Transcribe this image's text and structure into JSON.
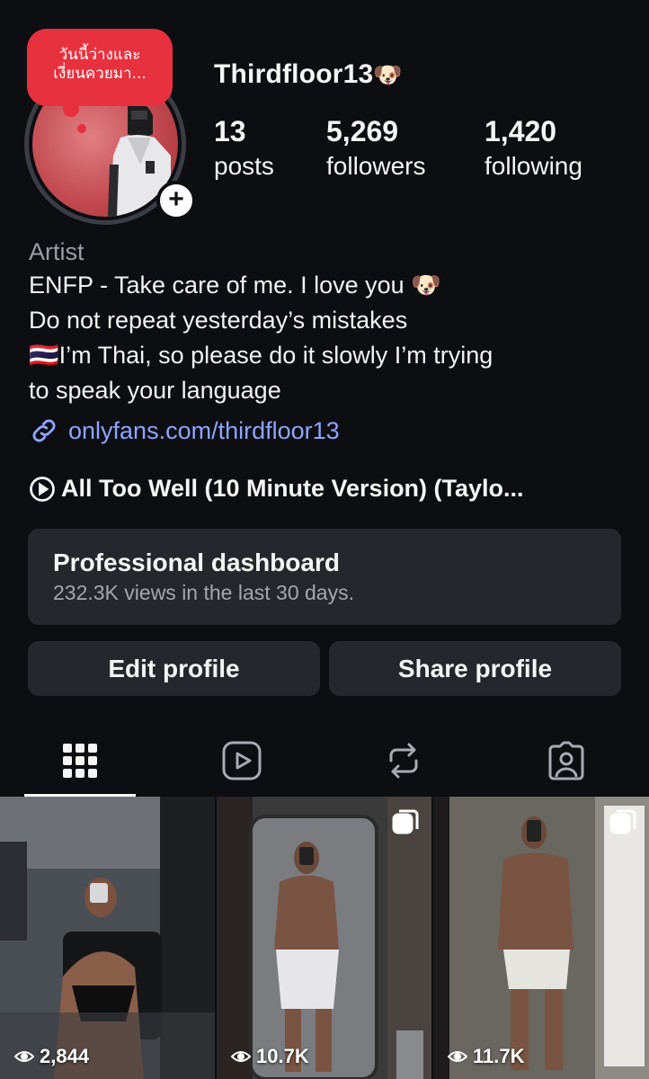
{
  "profile": {
    "note": [
      "วันนี้ว่างและ",
      "เงี่ยนควยมา..."
    ],
    "username": "Thirdfloor13",
    "username_emoji": "🐶",
    "stats": [
      {
        "value": "13",
        "label": "posts"
      },
      {
        "value": "5,269",
        "label": "followers"
      },
      {
        "value": "1,420",
        "label": "following"
      }
    ]
  },
  "bio": {
    "category": "Artist",
    "lines": [
      "ENFP - Take care of me. I love you 🐶",
      "Do not repeat yesterday’s mistakes",
      "🇹🇭I’m Thai, so please do it slowly I’m trying",
      "to speak your language"
    ],
    "link": "onlyfans.com/thirdfloor13",
    "music": "All Too Well (10 Minute Version) (Taylo..."
  },
  "dashboard": {
    "title": "Professional dashboard",
    "subtitle": "232.3K views in the last 30 days."
  },
  "buttons": {
    "edit": "Edit profile",
    "share": "Share profile"
  },
  "tabs": [
    {
      "icon": "grid-icon",
      "active": true
    },
    {
      "icon": "reels-icon",
      "active": false
    },
    {
      "icon": "reposts-icon",
      "active": false
    },
    {
      "icon": "tagged-icon",
      "active": false
    }
  ],
  "posts": [
    {
      "views": "2,844",
      "multi": false
    },
    {
      "views": "10.7K",
      "multi": true
    },
    {
      "views": "11.7K",
      "multi": true
    }
  ],
  "colors": {
    "background": "#0c0e12",
    "card": "#25272c",
    "link": "#8fa4ff",
    "note": "#e8313e"
  }
}
